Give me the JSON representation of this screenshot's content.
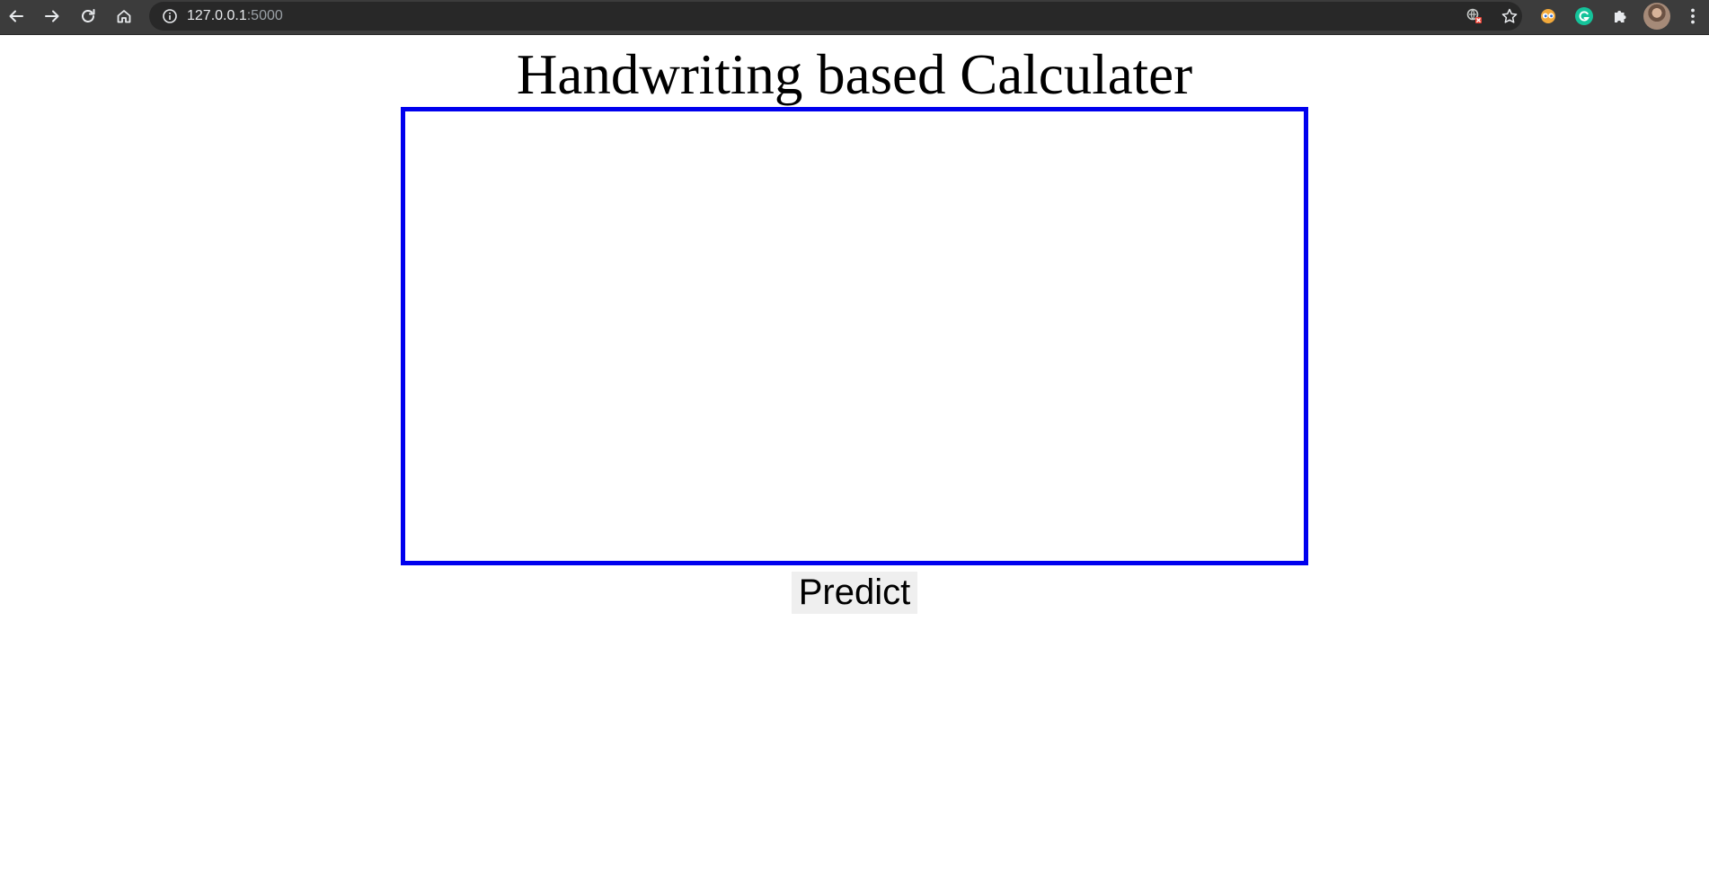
{
  "browser": {
    "url_host": "127.0.0.1",
    "url_port": ":5000",
    "icons": {
      "back": "arrow-left-icon",
      "forward": "arrow-right-icon",
      "reload": "reload-icon",
      "home": "home-icon",
      "site_info": "info-icon",
      "translate": "translate-blocked-icon",
      "bookmark": "star-icon",
      "extension_1": "eyes-extension-icon",
      "extension_2": "grammarly-icon",
      "extensions": "puzzle-icon",
      "profile": "avatar",
      "menu": "kebab-menu-icon"
    },
    "colors": {
      "toolbar": "#3c3c3c",
      "omnibox": "#282828",
      "grammarly": "#15c39a"
    }
  },
  "page": {
    "title": "Handwriting based Calculater",
    "canvas_border_color": "#0000ee",
    "predict_label": "Predict"
  }
}
